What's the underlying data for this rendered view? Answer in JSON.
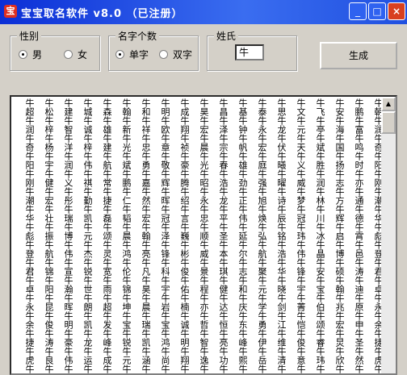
{
  "window": {
    "title": "宝宝取名软件 v8.0  （已注册）",
    "icon": "app-icon"
  },
  "titlebar_buttons": {
    "minimize": "_",
    "maximize": "□",
    "close": "×"
  },
  "gender": {
    "label": "性别",
    "options": [
      {
        "label": "男",
        "selected": true
      },
      {
        "label": "女",
        "selected": false
      }
    ]
  },
  "name_count": {
    "label": "名字个数",
    "options": [
      {
        "label": "单字",
        "selected": true
      },
      {
        "label": "双字",
        "selected": false
      }
    ]
  },
  "surname": {
    "label": "姓氏",
    "value": "牛"
  },
  "generate_button": {
    "label": "生成"
  },
  "output": {
    "columns": [
      "牛朝牛润牛奇牛阳牛刚牛潮牛华牛彪牛登牛君牛卓牛永牛余牛捷牛虎牛思牛刚牛雷牛杉牛智牛昆牛吉牛余牛枫牛福",
      "牛鹏牛富牛鸣牛时牛亦牛通牛德牛霄牛邑牛涛牛迪牛原牛申牛圣牛然牛明牛昊牛源牛捷牛涌牛元牛伊牛侃牛诸牛海",
      "牛安牛海牛国牛扬牛志牛方牛辉牛启牛博牛硕牛翰牛兆牛宏牛炅牛欣牛宁牛秋牛皓牛寿牛强牛翔牛方牛岩牛雄",
      "牛飞牛亭牛斌牛胜牛润牛林牛川牛冰牛晶牛安牛宝牛伯牛颂牛睿牛玮牛赫牛宣牛宗牛名牛翰牛曦牛越牛劳牛涵",
      "牛文牛元牛天牛义牛威牛梦牛冠牛玮牛伟牛锋牛宇牛菁牛恺牛俊牛意牛文牛朋牛中牛天牛悦牛鲁牛锦牛琪",
      "牛思牛龙牛伏牛曦牛曜牛诗牛辰牛铭牛浩牛华牛晓牛剑牛江牛维牛清牛文牛汇牛逸牛洋牛勋牛川牛杰牛湖",
      "牛泰牛永牛宏牛庭牛强牛旭牛焕牛弘牛航牛聚牛元牛学牛勇牛伊牛岳牛力牛晨牛智牛成牛洁牛贤牛明牛晖",
      "牛基牛钟牛帆牛雄牛劲牛正牛伟牛延牛尔牛志牛和牛庆牛东牛峰牛熙牛勃牛浩牛洲牛海牛剑牛朔牛峻牛泓",
      "牛昌牛泽牛宗牛春牛浩牛龙牛平牛圣牛本牛琪牛健牛达牛恒牛亮牛功牛阳牛俊牛洛牛卫牛志牛康牛德牛锋",
      "牛昊牛宏牛晨牛光牛昭牛永牛忠牛顺牛威牛景牛程牛亦牛哲牛智牛逸牛晓牛政牛星牛振牛君牛晨牛润牛智",
      "牛成牛翔牛祯牛豪牛腾牛绍牛言牛巍牛彬牛俊牛佑牛楠牛诚牛明牛翔牛冬牛森牛锐牛洪牛宁牛桐牛俊牛明",
      "牛明牛欧牛章牛敬牛辉牛晖牛冠牛泽牛锋牛科牛宇牛岩牛宝牛鸿牛尚牛钧牛豪牛旋牛策牛福牛生牛勋牛进",
      "牛和牛祥牛忠牛勇牛嘉牛然牛宏牛翰牛亮牛凡牛昊牛晨牛瑞牛凯牛涵牛洪牛振牛耀牛祥牛凯牛哲牛家牛平",
      "牛翰牛新牛光牛斌牛鹏牛仁牛韬牛晨牛鸿牛伦牛锦牛坤牛宝牛锐牛元牛成牛维牛迪牛骥牛颖牛敏牛振牛东",
      "牛森牛雄牛建牛航牛常牛捷牛磊牛颂牛灵牛宽牛雨牛超牛发牛峰牛成牛涛牛岚牛翔牛涛牛龙牛宇牛江牛渊",
      "牛城牛诚牛梓牛伟牛祺牛勤牛凯牛元牛杰牛锐牛世牛朗牛凯牛龙牛运牛辉牛乐牛星牛欣牛杰牛越牛睿牛骏",
      "牛建牛智牛洋牛润牛义牛彤牛瑞牛博牛伟牛宣牛瀚牛晖牛明牛豪牛伟牛高牛东牛星牛京牛骏牛成牛楠牛瑞",
      "牛松牛梓牛杨牛宇牛健牛宏牛壮牛振牛航牛锦牛阳牛昆牛俊牛涛牛良牛恒牛宏牛宇牛浩牛晋牛博牛翔牛冰",
      "牛超牛润牛奇牛阳牛刚牛潮牛华牛彪牛登牛君牛卓牛永牛余牛捷牛虎牛思牛刚牛雷牛杉牛智牛昆牛吉牛余"
    ]
  }
}
